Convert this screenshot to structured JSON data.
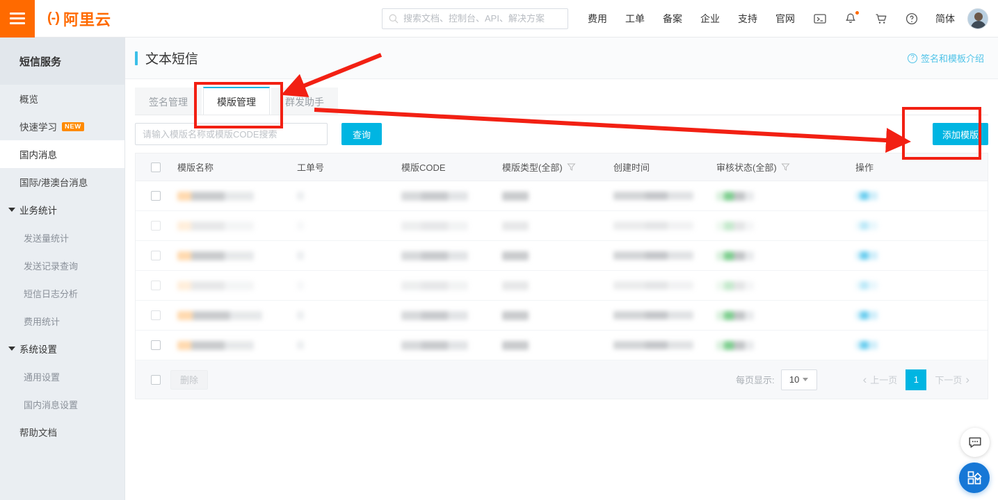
{
  "topbar": {
    "logo_text": "阿里云",
    "logo_mark": "(-)",
    "search_placeholder": "搜索文档、控制台、API、解决方案",
    "nav": [
      {
        "label": "费用"
      },
      {
        "label": "工单"
      },
      {
        "label": "备案"
      },
      {
        "label": "企业"
      },
      {
        "label": "支持"
      },
      {
        "label": "官网"
      }
    ],
    "lang": "简体",
    "icons": [
      "terminal-icon",
      "bell-icon",
      "cart-icon",
      "help-icon"
    ]
  },
  "sidebar": {
    "title": "短信服务",
    "items": [
      {
        "label": "概览",
        "type": "item",
        "active": false
      },
      {
        "label": "快速学习",
        "type": "item",
        "badge": "NEW",
        "active": false
      },
      {
        "label": "国内消息",
        "type": "item",
        "active": true
      },
      {
        "label": "国际/港澳台消息",
        "type": "item",
        "active": false
      },
      {
        "label": "业务统计",
        "type": "group",
        "active": false
      },
      {
        "label": "发送量统计",
        "type": "sub",
        "active": false
      },
      {
        "label": "发送记录查询",
        "type": "sub",
        "active": false
      },
      {
        "label": "短信日志分析",
        "type": "sub",
        "active": false
      },
      {
        "label": "费用统计",
        "type": "sub",
        "active": false
      },
      {
        "label": "系统设置",
        "type": "group",
        "active": false
      },
      {
        "label": "通用设置",
        "type": "sub",
        "active": false
      },
      {
        "label": "国内消息设置",
        "type": "sub",
        "active": false
      },
      {
        "label": "帮助文档",
        "type": "item",
        "active": false
      }
    ]
  },
  "page": {
    "title": "文本短信",
    "help_link": "签名和模板介绍"
  },
  "tabs": [
    {
      "label": "签名管理",
      "active": false
    },
    {
      "label": "模版管理",
      "active": true
    },
    {
      "label": "群发助手",
      "active": false
    }
  ],
  "filter": {
    "search_placeholder": "请输入模版名称或模版CODE搜索",
    "search_value": "",
    "query_label": "查询",
    "add_label": "添加模版"
  },
  "table": {
    "columns": [
      {
        "label": "模版名称",
        "filter": false
      },
      {
        "label": "工单号",
        "filter": false
      },
      {
        "label": "模版CODE",
        "filter": false
      },
      {
        "label": "模版类型(全部)",
        "filter": true
      },
      {
        "label": "创建时间",
        "filter": false
      },
      {
        "label": "审核状态(全部)",
        "filter": true
      },
      {
        "label": "操作",
        "filter": false
      }
    ],
    "rows": [
      {
        "redacted": true,
        "faint": false
      },
      {
        "redacted": true,
        "faint": true
      },
      {
        "redacted": true,
        "faint": false
      },
      {
        "redacted": true,
        "faint": true
      },
      {
        "redacted": true,
        "faint": false
      },
      {
        "redacted": true,
        "faint": false
      }
    ]
  },
  "footer": {
    "delete_label": "删除",
    "per_page_label": "每页显示:",
    "per_page_value": "10",
    "prev_label": "上一页",
    "current_page": "1",
    "next_label": "下一页"
  },
  "annotations": {
    "color": "#f22013",
    "shapes": [
      "tab-highlight-rect",
      "add-button-highlight-rect",
      "arrow-to-tab",
      "arrow-to-add-button"
    ]
  },
  "fab": {
    "chat": "chat-bubble-icon",
    "apps": "apps-grid-icon"
  },
  "colors": {
    "brand_orange": "#ff6a00",
    "accent_cyan": "#00b5e2",
    "sidebar_bg": "#eaeef2",
    "annotation_red": "#f22013",
    "fab_blue": "#1677d6"
  }
}
